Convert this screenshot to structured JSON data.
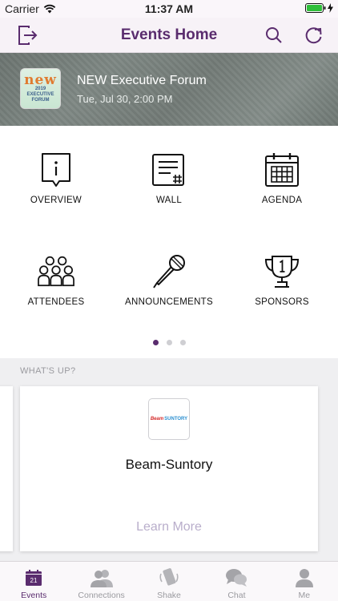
{
  "status_bar": {
    "carrier": "Carrier",
    "time": "11:37 AM"
  },
  "nav": {
    "title": "Events Home",
    "left_icon": "exit-icon",
    "search_icon": "search-icon",
    "refresh_icon": "refresh-icon"
  },
  "event": {
    "title": "NEW Executive Forum",
    "date": "Tue, Jul 30, 2:00 PM",
    "logo": {
      "mark": "new",
      "year": "2019",
      "line1": "EXECUTIVE",
      "line2": "FORUM"
    }
  },
  "menu": {
    "items": [
      {
        "label": "OVERVIEW",
        "icon": "info-icon"
      },
      {
        "label": "WALL",
        "icon": "wall-icon"
      },
      {
        "label": "AGENDA",
        "icon": "calendar-icon"
      },
      {
        "label": "ATTENDEES",
        "icon": "people-icon"
      },
      {
        "label": "ANNOUNCEMENTS",
        "icon": "microphone-icon"
      },
      {
        "label": "SPONSORS",
        "icon": "trophy-icon"
      }
    ],
    "pages": 3,
    "current_page": 1
  },
  "whats_up": {
    "header": "WHAT'S UP?",
    "card": {
      "logo_beam": "Beam",
      "logo_suntory": "SUNTORY",
      "name": "Beam-Suntory",
      "action": "Learn More"
    }
  },
  "tabs": [
    {
      "label": "Events",
      "icon": "calendar-icon",
      "badge": "21",
      "active": true
    },
    {
      "label": "Connections",
      "icon": "connections-icon",
      "active": false
    },
    {
      "label": "Shake",
      "icon": "shake-icon",
      "active": false
    },
    {
      "label": "Chat",
      "icon": "chat-icon",
      "active": false
    },
    {
      "label": "Me",
      "icon": "person-icon",
      "active": false
    }
  ],
  "colors": {
    "accent": "#5a2c6e",
    "inactive": "#9a9a9f",
    "learn_more": "#b9aecb"
  }
}
